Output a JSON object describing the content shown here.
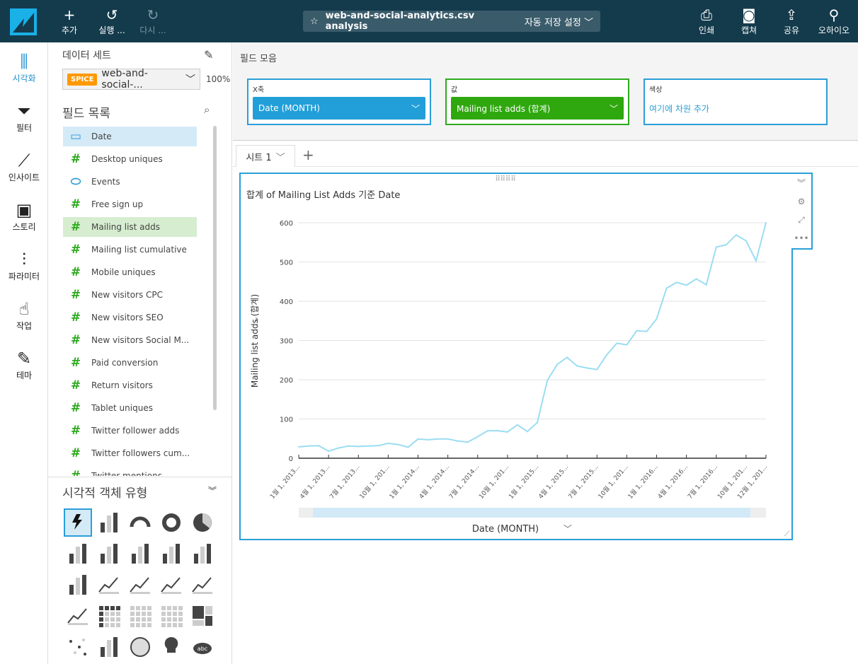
{
  "topbar": {
    "add": "추가",
    "undo": "실행 ...",
    "redo": "다시 ...",
    "title": "web-and-social-analytics.csv analysis",
    "autosave": "자동 저장 설정",
    "print": "인쇄",
    "capture": "캡쳐",
    "share": "공유",
    "region": "오하이오"
  },
  "rail": [
    {
      "label": "시각화",
      "icon": "bar-chart-icon"
    },
    {
      "label": "필터",
      "icon": "filter-icon"
    },
    {
      "label": "인사이트",
      "icon": "insights-icon"
    },
    {
      "label": "스토리",
      "icon": "story-icon"
    },
    {
      "label": "파라미터",
      "icon": "parameters-icon"
    },
    {
      "label": "작업",
      "icon": "actions-icon"
    },
    {
      "label": "테마",
      "icon": "theme-icon"
    }
  ],
  "panel": {
    "dataset_label": "데이터 세트",
    "spice": "SPICE",
    "dataset": "web-and-social-...",
    "percent": "100%",
    "fields_label": "필드 목록",
    "fields": [
      {
        "name": "Date",
        "type": "date"
      },
      {
        "name": "Desktop uniques",
        "type": "measure"
      },
      {
        "name": "Events",
        "type": "dimension"
      },
      {
        "name": "Free sign up",
        "type": "measure"
      },
      {
        "name": "Mailing list adds",
        "type": "measure"
      },
      {
        "name": "Mailing list cumulative",
        "type": "measure"
      },
      {
        "name": "Mobile uniques",
        "type": "measure"
      },
      {
        "name": "New visitors CPC",
        "type": "measure"
      },
      {
        "name": "New visitors SEO",
        "type": "measure"
      },
      {
        "name": "New visitors Social M...",
        "type": "measure"
      },
      {
        "name": "Paid conversion",
        "type": "measure"
      },
      {
        "name": "Return visitors",
        "type": "measure"
      },
      {
        "name": "Tablet uniques",
        "type": "measure"
      },
      {
        "name": "Twitter follower adds",
        "type": "measure"
      },
      {
        "name": "Twitter followers cum...",
        "type": "measure"
      },
      {
        "name": "Twitter mentions",
        "type": "measure"
      }
    ],
    "visual_types_label": "시각적 객체 유형",
    "visual_types": [
      "autograph",
      "kpi",
      "gauge",
      "donut",
      "pie",
      "horizontal-bar",
      "vertical-bar",
      "horizontal-stacked-bar",
      "vertical-stacked-bar",
      "horizontal-100-bar",
      "vertical-100-bar",
      "line",
      "area",
      "combo-clustered",
      "combo-stacked",
      "stacked-area",
      "pivot-table",
      "table",
      "heat-map",
      "tree-map",
      "scatter",
      "histogram",
      "geo-map",
      "insight",
      "word-cloud"
    ]
  },
  "wells": {
    "title": "필드 모음",
    "x_label": "X축",
    "x_value": "Date (MONTH)",
    "value_label": "값",
    "value_value": "Mailing list adds (합계)",
    "color_label": "색상",
    "color_placeholder": "여기에 차원 추가"
  },
  "sheet": {
    "tab": "시트 1"
  },
  "colors": {
    "accent": "#2a9fd8",
    "green": "#2daa1e",
    "line": "#9bddf2",
    "topbar": "#143b4c"
  },
  "chart_data": {
    "type": "line",
    "title": "합계 of Mailing List Adds 기준 Date",
    "xlabel": "Date (MONTH)",
    "ylabel": "Mailing list adds (합계)",
    "ylim": [
      0,
      600
    ],
    "yticks": [
      0,
      100,
      200,
      300,
      400,
      500,
      600
    ],
    "grid": true,
    "x_tick_labels": [
      {
        "i": 0,
        "label": "1월 1, 2013..."
      },
      {
        "i": 3,
        "label": "4월 1, 2013..."
      },
      {
        "i": 6,
        "label": "7월 1, 2013..."
      },
      {
        "i": 9,
        "label": "10월 1, 201..."
      },
      {
        "i": 12,
        "label": "1월 1, 2014..."
      },
      {
        "i": 15,
        "label": "4월 1, 2014..."
      },
      {
        "i": 18,
        "label": "7월 1, 2014..."
      },
      {
        "i": 21,
        "label": "10월 1, 201..."
      },
      {
        "i": 24,
        "label": "1월 1, 2015..."
      },
      {
        "i": 27,
        "label": "4월 1, 2015..."
      },
      {
        "i": 30,
        "label": "7월 1, 2015..."
      },
      {
        "i": 33,
        "label": "10월 1, 201..."
      },
      {
        "i": 36,
        "label": "1월 1, 2016..."
      },
      {
        "i": 39,
        "label": "4월 1, 2016..."
      },
      {
        "i": 42,
        "label": "7월 1, 2016..."
      },
      {
        "i": 45,
        "label": "10월 1, 201..."
      },
      {
        "i": 47,
        "label": "12월 1, 201..."
      }
    ],
    "values": [
      29,
      31,
      32,
      18,
      26,
      31,
      30,
      31,
      32,
      38,
      35,
      28,
      49,
      47,
      49,
      49,
      44,
      41,
      55,
      70,
      70,
      67,
      85,
      68,
      91,
      198,
      239,
      257,
      235,
      230,
      226,
      264,
      293,
      289,
      325,
      323,
      355,
      433,
      448,
      441,
      457,
      442,
      538,
      544,
      569,
      554,
      503,
      600
    ]
  }
}
